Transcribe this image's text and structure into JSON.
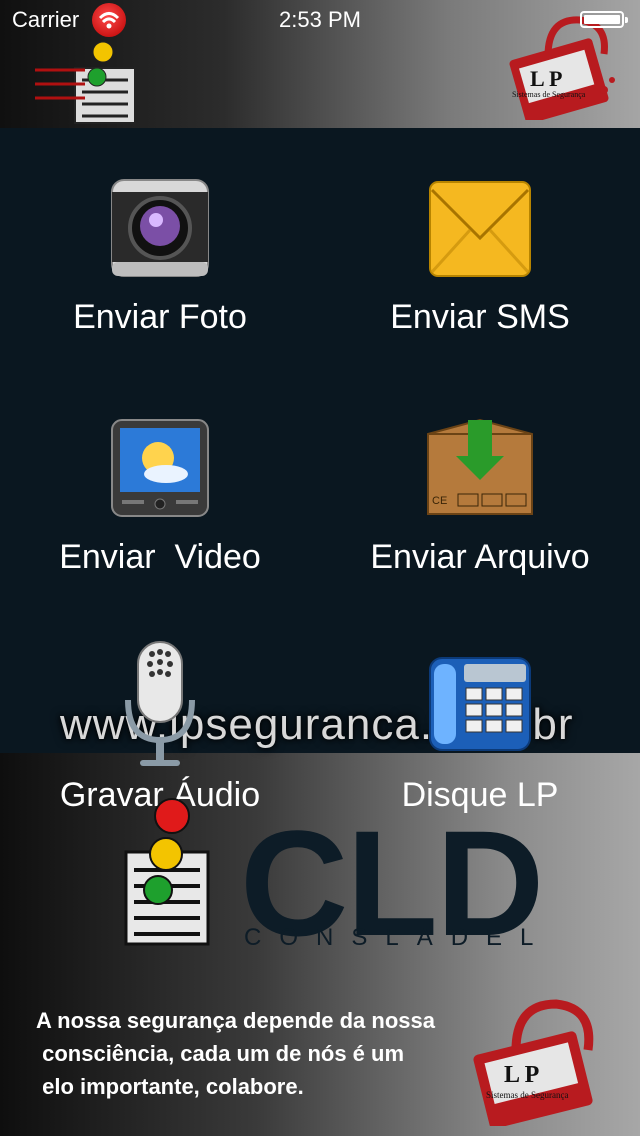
{
  "status_bar": {
    "carrier": "Carrier",
    "time": "2:53 PM"
  },
  "brand": {
    "lp_logo_text": "L P",
    "lp_logo_subtext": "Sistemas de Segurança",
    "cld_text": "CLD",
    "cld_subtext": "CONSLADEL",
    "watermark": "www.lpseguranca.com.br"
  },
  "menu": {
    "foto": "Enviar Foto",
    "sms": "Enviar SMS",
    "video": "Enviar  Video",
    "arquivo": "Enviar Arquivo",
    "audio": "Gravar Áudio",
    "disque": "Disque LP"
  },
  "icons": {
    "foto": "camera-icon",
    "sms": "envelope-icon",
    "video": "tv-icon",
    "arquivo": "package-download-icon",
    "audio": "microphone-icon",
    "disque": "phone-icon"
  },
  "tagline": {
    "line1": "A nossa segurança depende da nossa",
    "line2": " consciência, cada um de nós é um",
    "line3": " elo importante, colabore."
  },
  "colors": {
    "accent_red": "#c0191e",
    "dark_navy": "#0a1720",
    "envelope_yellow": "#f5b820"
  }
}
